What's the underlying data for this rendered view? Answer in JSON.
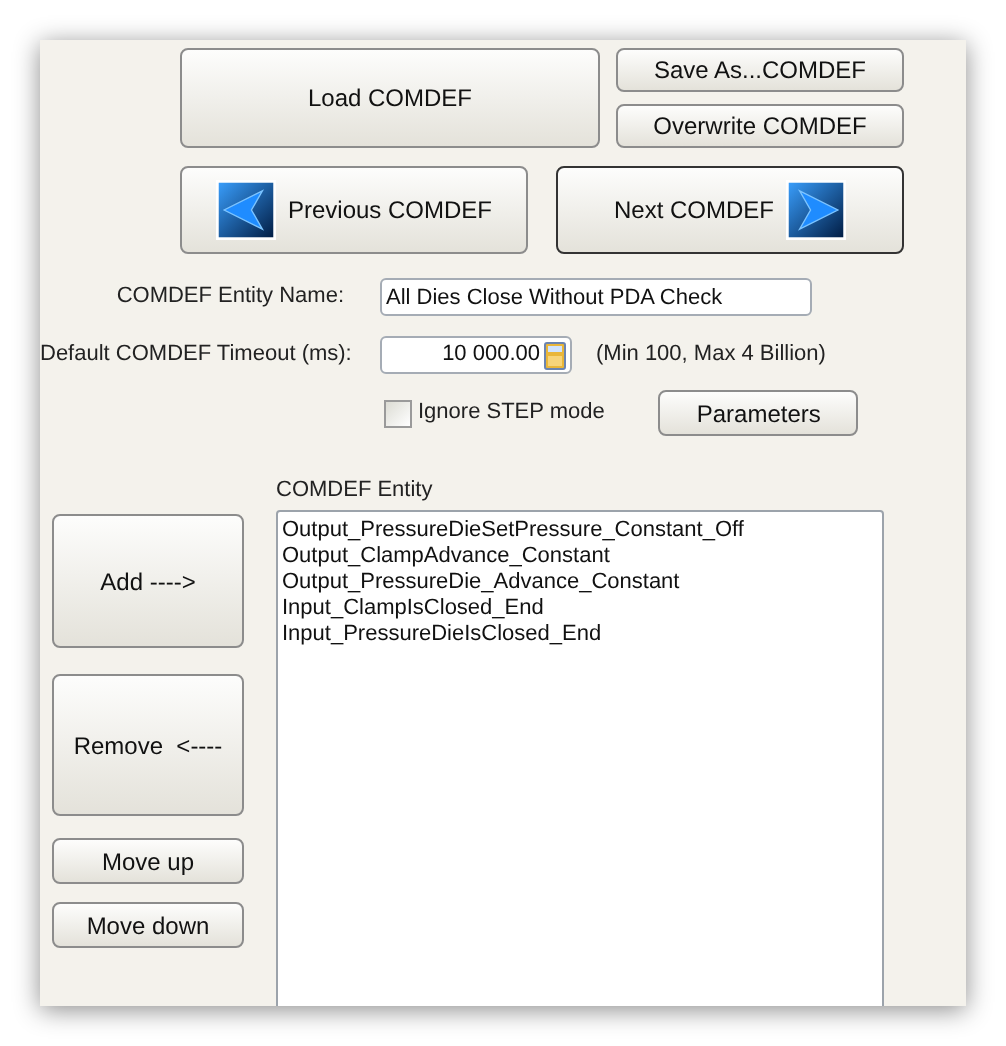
{
  "load_button": "Load COMDEF",
  "save_as_button": "Save As...COMDEF",
  "overwrite_button": "Overwrite COMDEF",
  "nav_buttons": [
    {
      "label": "Previous COMDEF",
      "kind": "previous",
      "default": false
    },
    {
      "label": "Next COMDEF",
      "kind": "next",
      "default": true
    }
  ],
  "entity_name": {
    "label": "COMDEF Entity Name:",
    "value": "All Dies Close Without PDA Check"
  },
  "timeout": {
    "label": "Default COMDEF Timeout (ms):",
    "value": "10 000.00",
    "hint": "(Min 100, Max 4 Billion)"
  },
  "ignore_step": {
    "label": "Ignore STEP mode",
    "checked": false
  },
  "parameters_button": "Parameters",
  "entity_list": {
    "label": "COMDEF Entity",
    "items": [
      "Output_PressureDieSetPressure_Constant_Off",
      "Output_ClampAdvance_Constant",
      "Output_PressureDie_Advance_Constant",
      "Input_ClampIsClosed_End",
      "Input_PressureDieIsClosed_End"
    ]
  },
  "side_buttons": [
    "Add ---->",
    "Remove  <----",
    "Move up",
    "Move down"
  ]
}
